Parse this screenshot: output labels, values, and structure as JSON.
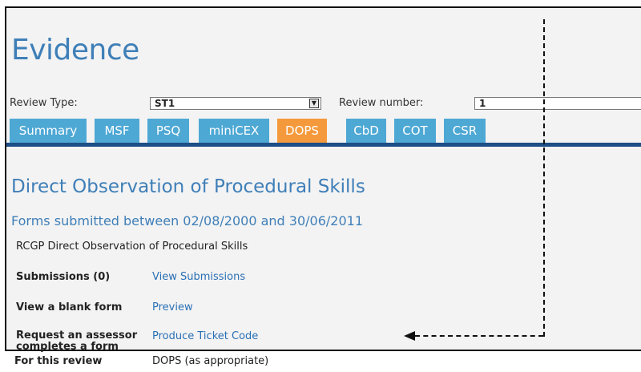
{
  "page": {
    "title": "Evidence"
  },
  "filters": {
    "review_type_label": "Review Type:",
    "review_type_value": "ST1",
    "review_number_label": "Review number:",
    "review_number_value": "1"
  },
  "tabs": [
    {
      "label": "Summary",
      "active": false
    },
    {
      "label": "MSF",
      "active": false
    },
    {
      "label": "PSQ",
      "active": false
    },
    {
      "label": "miniCEX",
      "active": false
    },
    {
      "label": "DOPS",
      "active": true
    },
    {
      "label": "CbD",
      "active": false
    },
    {
      "label": "COT",
      "active": false
    },
    {
      "label": "CSR",
      "active": false
    }
  ],
  "section": {
    "title": "Direct Observation of Procedural Skills",
    "date_range": "Forms submitted between 02/08/2000 and 30/06/2011",
    "form_name": "RCGP Direct Observation of Procedural Skills"
  },
  "rows": {
    "submissions_label": "Submissions (0)",
    "submissions_link": "View Submissions",
    "blank_form_label": "View a blank form",
    "blank_form_link": "Preview",
    "request_label": "Request an assessor completes a form",
    "request_link": "Produce Ticket Code",
    "review_label": "For this review",
    "review_value": "DOPS (as appropriate)"
  },
  "colors": {
    "accent_blue": "#3f7fb8",
    "tab_blue": "#4ea8d4",
    "tab_active": "#f59a3c",
    "tabbar_line": "#1d4e86",
    "link": "#2a6fb4"
  }
}
